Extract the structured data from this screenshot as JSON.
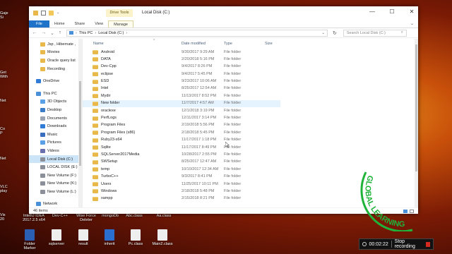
{
  "window": {
    "title": "Local Disk (C:)",
    "context_tab": "Drive Tools",
    "controls": {
      "minimize": "—",
      "maximize": "☐",
      "close": "✕"
    }
  },
  "ribbon": {
    "tabs": [
      "File",
      "Home",
      "Share",
      "View",
      "Manage"
    ],
    "expand": "⌄"
  },
  "address": {
    "back": "←",
    "forward": "→",
    "up_recent": "⌄",
    "up": "↑",
    "crumbs": [
      "This PC",
      "Local Disk (C:)"
    ],
    "separator": "›",
    "dropdown": "⌄",
    "refresh": "↻",
    "search_placeholder": "Search Local Disk (C:)",
    "search_icon": "⌕"
  },
  "nav": {
    "items": [
      {
        "label": "Jsp , Hibernate ,",
        "icon": "folder-icon"
      },
      {
        "label": "Movies",
        "icon": "folder-icon"
      },
      {
        "label": "Oracle query list",
        "icon": "folder-icon"
      },
      {
        "label": "Recording",
        "icon": "folder-icon"
      },
      {
        "label": "",
        "icon": ""
      },
      {
        "label": "OneDrive",
        "icon": "onedrive-icon"
      },
      {
        "label": "",
        "icon": ""
      },
      {
        "label": "This PC",
        "icon": "computer-icon"
      },
      {
        "label": "3D Objects",
        "icon": "cube-icon"
      },
      {
        "label": "Desktop",
        "icon": "desktop-icon"
      },
      {
        "label": "Documents",
        "icon": "documents-icon"
      },
      {
        "label": "Downloads",
        "icon": "download-icon"
      },
      {
        "label": "Music",
        "icon": "music-icon"
      },
      {
        "label": "Pictures",
        "icon": "pictures-icon"
      },
      {
        "label": "Videos",
        "icon": "videos-icon"
      },
      {
        "label": "Local Disk (C:)",
        "icon": "drive-icon"
      },
      {
        "label": "LOCAL DISK (E:)",
        "icon": "drive-icon"
      },
      {
        "label": "New Volume (F:)",
        "icon": "drive-icon"
      },
      {
        "label": "New Volume (K:)",
        "icon": "drive-icon"
      },
      {
        "label": "New Volume (L:)",
        "icon": "drive-icon"
      },
      {
        "label": "",
        "icon": ""
      },
      {
        "label": "Network",
        "icon": "network-icon"
      }
    ],
    "selected_index": 15
  },
  "columns": {
    "name": "Name",
    "date": "Date modified",
    "type": "Type",
    "size": "Size",
    "sort_arrow": "^"
  },
  "files": [
    {
      "name": "Android",
      "date": "9/30/2017 9:29 AM",
      "type": "File folder"
    },
    {
      "name": "DATA",
      "date": "2/20/2018 5:16 PM",
      "type": "File folder"
    },
    {
      "name": "Dev-Cpp",
      "date": "9/4/2017 8:26 PM",
      "type": "File folder"
    },
    {
      "name": "eclipse",
      "date": "9/4/2017 5:45 PM",
      "type": "File folder"
    },
    {
      "name": "ESD",
      "date": "9/23/2017 10:06 AM",
      "type": "File folder"
    },
    {
      "name": "Intel",
      "date": "8/25/2017 12:54 AM",
      "type": "File folder"
    },
    {
      "name": "Mydir",
      "date": "11/13/2017 8:52 PM",
      "type": "File folder"
    },
    {
      "name": "New folder",
      "date": "11/7/2017 4:57 AM",
      "type": "File folder"
    },
    {
      "name": "oraclexe",
      "date": "12/1/2018 3:19 PM",
      "type": "File folder"
    },
    {
      "name": "PerfLogs",
      "date": "12/11/2017 3:14 PM",
      "type": "File folder"
    },
    {
      "name": "Program Files",
      "date": "2/19/2018 5:56 PM",
      "type": "File folder"
    },
    {
      "name": "Program Files (x86)",
      "date": "2/18/2018 5:45 PM",
      "type": "File folder"
    },
    {
      "name": "Ruby23-x64",
      "date": "11/17/2017 1:18 PM",
      "type": "File folder"
    },
    {
      "name": "Sqlite",
      "date": "11/17/2017 8:49 PM",
      "type": "File folder"
    },
    {
      "name": "SQLServer2017Media",
      "date": "10/28/2017 2:55 PM",
      "type": "File folder"
    },
    {
      "name": "SWSetup",
      "date": "8/25/2017 12:47 AM",
      "type": "File folder"
    },
    {
      "name": "temp",
      "date": "10/10/2017 12:34 AM",
      "type": "File folder"
    },
    {
      "name": "TurboC++",
      "date": "9/3/2017 8:41 PM",
      "type": "File folder"
    },
    {
      "name": "Users",
      "date": "11/25/2017 10:11 PM",
      "type": "File folder"
    },
    {
      "name": "Windows",
      "date": "2/18/2018 5:48 PM",
      "type": "File folder"
    },
    {
      "name": "xampp",
      "date": "2/15/2018 8:21 PM",
      "type": "File folder"
    }
  ],
  "hover_row_index": 7,
  "status": {
    "count": "46 items"
  },
  "desktop": {
    "left_fragments": [
      {
        "label": "Gaje\nSi"
      },
      {
        "label": "Get\nWith"
      },
      {
        "label": "Net"
      },
      {
        "label": "Co\nP"
      },
      {
        "label": "Net"
      },
      {
        "label": "VLC\nplay"
      },
      {
        "label": "Vis\n20"
      }
    ],
    "top_labels": [
      "IntelliJ IDEA\n2017.2.5 x64",
      "Dev-C++",
      "Wise Force\nDeleter",
      "mongoDb",
      "Abc.class",
      "Aa.class"
    ],
    "bottom_icons": [
      {
        "label": "Folder\nMarker",
        "color": "#2b5fb3"
      },
      {
        "label": "sqlserver",
        "color": "#eeeeee"
      },
      {
        "label": "result",
        "color": "#eeeeee"
      },
      {
        "label": "inherit",
        "color": "#2a6fcf"
      },
      {
        "label": "Pc.class",
        "color": "#eeeeee"
      },
      {
        "label": "Main2.class",
        "color": "#eeeeee"
      }
    ]
  },
  "watermark": {
    "text": "GLOBAL LEARNING",
    "color": "#1fb33a"
  },
  "recorder": {
    "time": "00:02:22",
    "stop_label": "Stop recording",
    "stop_color": "#d4291f"
  }
}
